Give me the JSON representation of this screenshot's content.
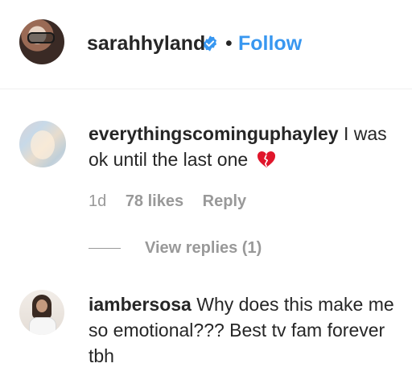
{
  "post_header": {
    "username": "sarahhyland",
    "verified_icon": "verified-badge-icon",
    "separator": "•",
    "follow_label": "Follow"
  },
  "comments": [
    {
      "username": "everythingscominguphayley",
      "text": " I was ok until the last one",
      "emoji_icon": "broken-heart-icon",
      "time": "1d",
      "likes": "78 likes",
      "reply_label": "Reply",
      "view_replies": "View replies (1)"
    },
    {
      "username": "iambersosa",
      "text": " Why does this make me so emotional??? Best tv fam forever tbh"
    }
  ],
  "colors": {
    "link_blue": "#3897f0",
    "text_dark": "#262626",
    "meta_gray": "#999999",
    "divider": "#efefef",
    "broken_heart_red": "#e0162b"
  }
}
